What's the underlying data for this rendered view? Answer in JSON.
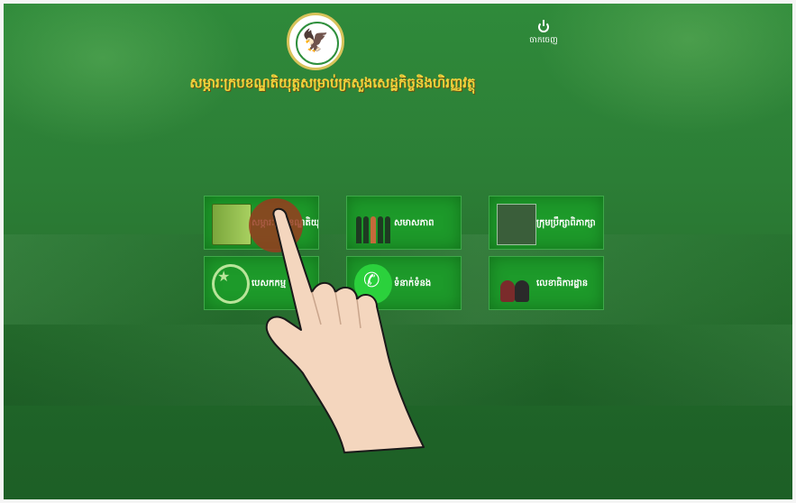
{
  "app": {
    "title": "សម្ភារៈក្របខណ្ឌតិយុត្តសម្រាប់ក្រសួងសេដ្ឋកិច្ចនិងហិរញ្ញវត្ថុ",
    "logo_icon": "ministry-seal-icon",
    "logout_label": "ចាកចេញ",
    "logout_icon": "power-icon"
  },
  "tiles": [
    {
      "label": "សម្ភារៈក្របខណ្ឌតិយុត្ត",
      "icon": "book-icon"
    },
    {
      "label": "សមាសភាព",
      "icon": "people-icon"
    },
    {
      "label": "ក្រុមប្រឹក្សាពិភាក្សា",
      "icon": "meeting-icon"
    },
    {
      "label": "បេសកកម្ម",
      "icon": "award-badge-icon"
    },
    {
      "label": "ទំនាក់ទំនង",
      "icon": "phone-icon"
    },
    {
      "label": "លេខាធិការដ្ឋាន",
      "icon": "officials-icon"
    }
  ],
  "colors": {
    "background": "#2c7e36",
    "tile": "#1d9a2a",
    "title": "#f2d23c",
    "tap_indicator": "#96401e"
  }
}
